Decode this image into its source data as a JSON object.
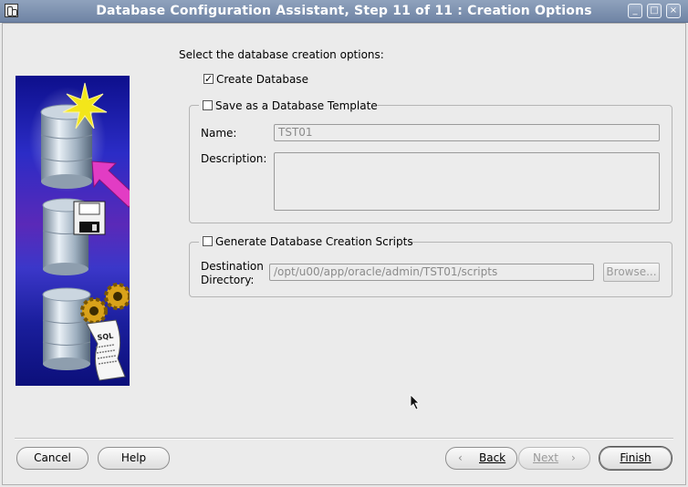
{
  "window": {
    "title": "Database Configuration Assistant, Step 11 of 11 : Creation Options",
    "controls": {
      "minimize": "_",
      "maximize": "□",
      "close": "×"
    }
  },
  "prompt": "Select the database creation options:",
  "options": {
    "create_database": {
      "label": "Create Database",
      "checked": true
    },
    "save_template": {
      "label": "Save as a Database Template",
      "checked": false,
      "name_label": "Name:",
      "name_value": "TST01",
      "description_label": "Description:",
      "description_value": ""
    },
    "generate_scripts": {
      "label": "Generate Database Creation Scripts",
      "checked": false,
      "dest_label_line1": "Destination",
      "dest_label_line2": "Directory:",
      "dest_value": "/opt/u00/app/oracle/admin/TST01/scripts",
      "browse_label": "Browse..."
    }
  },
  "image": {
    "sql_text": "SQL"
  },
  "buttons": {
    "cancel": "Cancel",
    "help": "Help",
    "back": "Back",
    "next": "Next",
    "finish": "Finish"
  },
  "colors": {
    "titlebar": "#7f93b1",
    "star": "#f3e61a",
    "arrow": "#e23cc4"
  }
}
